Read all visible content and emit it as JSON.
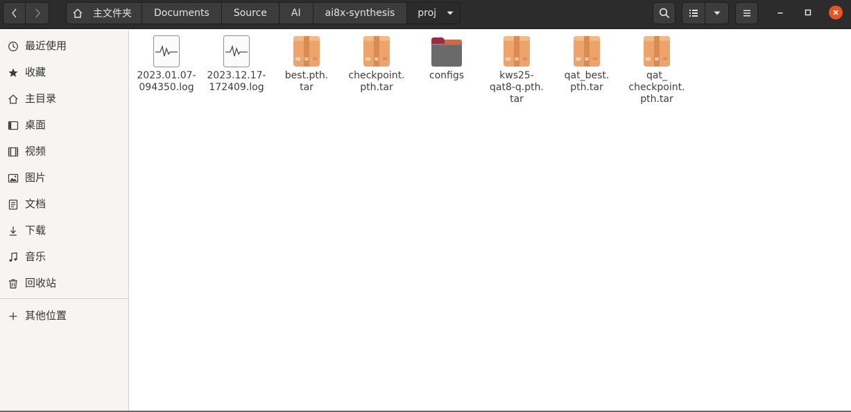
{
  "header": {
    "breadcrumbs": [
      {
        "label": "主文件夹",
        "icon": "home-icon"
      },
      {
        "label": "Documents"
      },
      {
        "label": "Source"
      },
      {
        "label": "AI"
      },
      {
        "label": "ai8x-synthesis"
      },
      {
        "label": "proj",
        "icon": "chevron-down-icon"
      }
    ]
  },
  "sidebar": {
    "items": [
      {
        "label": "最近使用",
        "icon": "recent-icon"
      },
      {
        "label": "收藏",
        "icon": "star-icon"
      },
      {
        "label": "主目录",
        "icon": "home-icon"
      },
      {
        "label": "桌面",
        "icon": "desktop-icon"
      },
      {
        "label": "视频",
        "icon": "video-icon"
      },
      {
        "label": "图片",
        "icon": "picture-icon"
      },
      {
        "label": "文档",
        "icon": "document-icon"
      },
      {
        "label": "下载",
        "icon": "download-icon"
      },
      {
        "label": "音乐",
        "icon": "music-icon"
      },
      {
        "label": "回收站",
        "icon": "trash-icon"
      },
      {
        "label": "其他位置",
        "icon": "plus-icon"
      }
    ]
  },
  "files": [
    {
      "name": "2023.01.07-094350.log",
      "label_lines": [
        "2023.01.07-",
        "094350.log"
      ],
      "type": "log"
    },
    {
      "name": "2023.12.17-172409.log",
      "label_lines": [
        "2023.12.17-",
        "172409.log"
      ],
      "type": "log"
    },
    {
      "name": "best.pth.tar",
      "label_lines": [
        "best.pth.",
        "tar"
      ],
      "type": "archive"
    },
    {
      "name": "checkpoint.pth.tar",
      "label_lines": [
        "checkpoint.",
        "pth.tar"
      ],
      "type": "archive"
    },
    {
      "name": "configs",
      "label_lines": [
        "configs"
      ],
      "type": "folder"
    },
    {
      "name": "kws25-qat8-q.pth.tar",
      "label_lines": [
        "kws25-",
        "qat8-q.pth.",
        "tar"
      ],
      "type": "archive"
    },
    {
      "name": "qat_best.pth.tar",
      "label_lines": [
        "qat_best.",
        "pth.tar"
      ],
      "type": "archive"
    },
    {
      "name": "qat_checkpoint.pth.tar",
      "label_lines": [
        "qat_",
        "checkpoint.",
        "pth.tar"
      ],
      "type": "archive"
    }
  ],
  "colors": {
    "headerbar": "#2c2c2c",
    "close_button": "#e95420",
    "archive": "#eda36a",
    "folder": "#6a6a6a",
    "folder_tab": "#9e2a45"
  }
}
